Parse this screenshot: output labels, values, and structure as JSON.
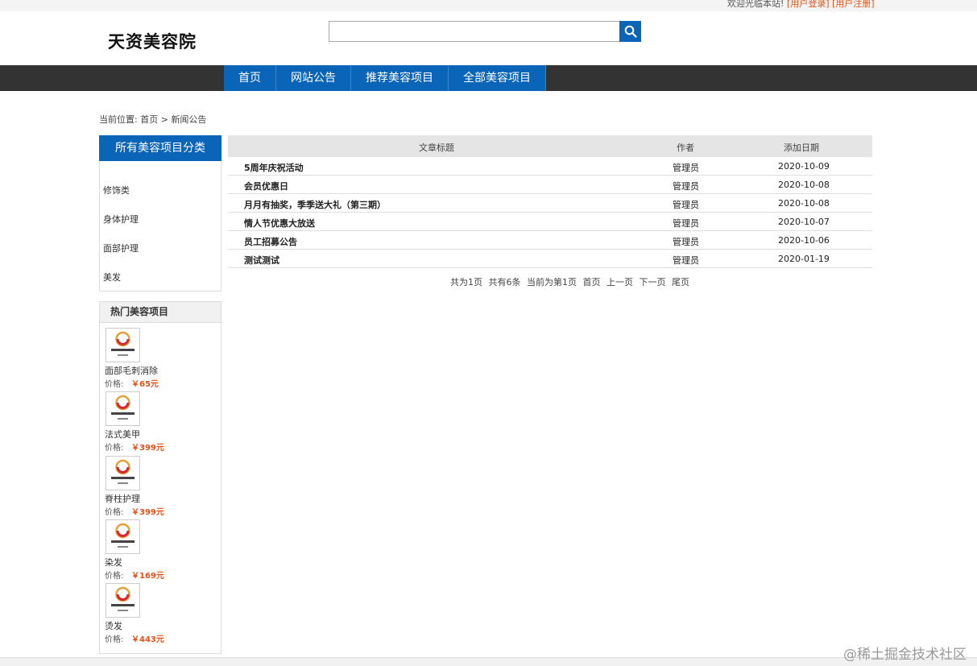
{
  "topbar": {
    "welcome": "欢迎光临本站!",
    "login": "[用户登录]",
    "register": "[用户注册]"
  },
  "header": {
    "logo": "天资美容院",
    "search_placeholder": "",
    "search_icon": "search-icon"
  },
  "nav": {
    "items": [
      "首页",
      "网站公告",
      "推荐美容项目",
      "全部美容项目"
    ]
  },
  "breadcrumb": {
    "prefix": "当前位置:",
    "home": "首页",
    "sep": ">",
    "current": "新闻公告"
  },
  "sidebar": {
    "category_title": "所有美容项目分类",
    "categories": [
      "修饰类",
      "身体护理",
      "面部护理",
      "美发"
    ],
    "hot_title": "热门美容项目",
    "price_label": "价格:",
    "hot_items": [
      {
        "name": "面部毛刺消除",
        "price": "￥65元"
      },
      {
        "name": "法式美甲",
        "price": "￥399元"
      },
      {
        "name": "脊柱护理",
        "price": "￥399元"
      },
      {
        "name": "染发",
        "price": "￥169元"
      },
      {
        "name": "烫发",
        "price": "￥443元"
      }
    ]
  },
  "table": {
    "headers": {
      "title": "文章标题",
      "author": "作者",
      "date": "添加日期"
    },
    "rows": [
      {
        "title": "5周年庆祝活动",
        "author": "管理员",
        "date": "2020-10-09"
      },
      {
        "title": "会员优惠日",
        "author": "管理员",
        "date": "2020-10-08"
      },
      {
        "title": "月月有抽奖，季季送大礼（第三期）",
        "author": "管理员",
        "date": "2020-10-08"
      },
      {
        "title": "情人节优惠大放送",
        "author": "管理员",
        "date": "2020-10-07"
      },
      {
        "title": "员工招募公告",
        "author": "管理员",
        "date": "2020-10-06"
      },
      {
        "title": "测试测试",
        "author": "管理员",
        "date": "2020-01-19"
      }
    ]
  },
  "pager": {
    "total_pages": "共为1页",
    "total_items": "共有6条",
    "current": "当前为第1页",
    "first": "首页",
    "prev": "上一页",
    "next": "下一页",
    "last": "尾页"
  },
  "watermark": "@稀土掘金技术社区",
  "colors": {
    "accent": "#0a64b8",
    "price": "#e4511a",
    "navbar": "#333333"
  }
}
